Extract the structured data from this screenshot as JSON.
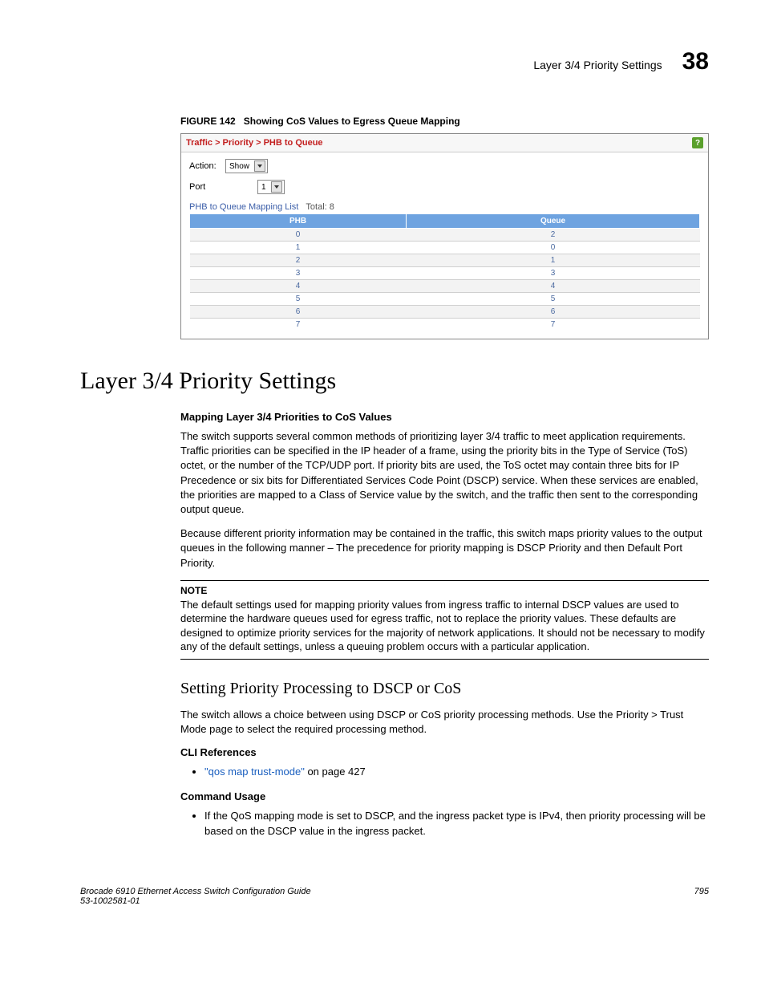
{
  "header": {
    "section": "Layer 3/4 Priority Settings",
    "chapter": "38"
  },
  "figure": {
    "label": "FIGURE 142",
    "caption": "Showing CoS Values to Egress Queue Mapping"
  },
  "panel": {
    "breadcrumb": "Traffic > Priority > PHB to Queue",
    "help": "?",
    "action_label": "Action:",
    "action_value": "Show",
    "port_label": "Port",
    "port_value": "1",
    "list_title": "PHB to Queue Mapping List",
    "list_total": "Total: 8",
    "cols": {
      "phb": "PHB",
      "queue": "Queue"
    },
    "rows": [
      {
        "phb": "0",
        "queue": "2"
      },
      {
        "phb": "1",
        "queue": "0"
      },
      {
        "phb": "2",
        "queue": "1"
      },
      {
        "phb": "3",
        "queue": "3"
      },
      {
        "phb": "4",
        "queue": "4"
      },
      {
        "phb": "5",
        "queue": "5"
      },
      {
        "phb": "6",
        "queue": "6"
      },
      {
        "phb": "7",
        "queue": "7"
      }
    ]
  },
  "body": {
    "h1": "Layer 3/4 Priority Settings",
    "sub1": "Mapping Layer 3/4 Priorities to CoS Values",
    "p1": "The switch supports several common methods of prioritizing layer 3/4 traffic to meet application requirements. Traffic priorities can be specified in the IP header of a frame, using the priority bits in the Type of Service (ToS) octet, or the number of the TCP/UDP port. If priority bits are used, the ToS octet may contain three bits for IP Precedence or six bits for Differentiated Services Code Point (DSCP) service. When these services are enabled, the priorities are mapped to a Class of Service value by the switch, and the traffic then sent to the corresponding output queue.",
    "p2": "Because different priority information may be contained in the traffic, this switch maps priority values to the output queues in the following manner – The precedence for priority mapping is DSCP Priority and then Default Port Priority.",
    "note_title": "NOTE",
    "note_text": "The default settings used for mapping priority values from ingress traffic to internal DSCP values are used to determine the hardware queues used for egress traffic, not to replace the priority values. These defaults are designed to optimize priority services for the majority of network applications. It should not be necessary to modify any of the default settings, unless a queuing problem occurs with a particular application.",
    "h2": "Setting Priority Processing to DSCP or CoS",
    "p3": "The switch allows a choice between using DSCP or CoS priority processing methods. Use the Priority > Trust Mode page to select the required processing method.",
    "cli_title": "CLI References",
    "cli_link": "\"qos map trust-mode\"",
    "cli_suffix": " on page 427",
    "cmd_title": "Command Usage",
    "cmd_text": "If the QoS mapping mode is set to DSCP, and the ingress packet type is IPv4, then priority processing will be based on the DSCP value in the ingress packet."
  },
  "footer": {
    "left1": "Brocade 6910 Ethernet Access Switch Configuration Guide",
    "left2": "53-1002581-01",
    "right": "795"
  }
}
